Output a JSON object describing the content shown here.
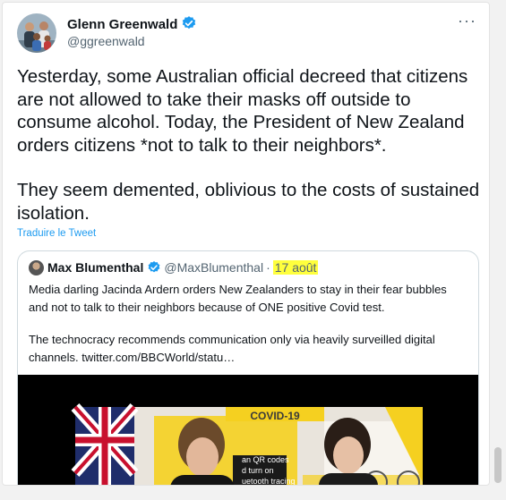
{
  "tweet": {
    "author_name": "Glenn Greenwald",
    "author_handle": "@ggreenwald",
    "more_label": "···",
    "paragraph1": "Yesterday, some Australian official decreed that citizens are not allowed to take their masks off outside to consume alcohol. Today, the President of New Zealand orders citizens *not to talk to their neighbors*.",
    "paragraph2": "They seem demented, oblivious to the costs of sustained isolation.",
    "translate_label": "Traduire le Tweet"
  },
  "quote": {
    "author_name": "Max Blumenthal",
    "author_handle": "@MaxBlumenthal",
    "separator": "·",
    "date": "17 août",
    "paragraph1": "Media darling Jacinda Ardern orders New Zealanders to stay in their fear bubbles and not to talk to their neighbors because of ONE positive Covid test.",
    "paragraph2": "The technocracy recommends communication only via heavily surveilled digital channels.  twitter.com/BBCWorld/statu…",
    "video": {
      "banner": "COVID-19",
      "sign_lines": [
        "an QR codes",
        "d turn on",
        "uetooth tracing"
      ]
    }
  },
  "colors": {
    "link": "#1d9bf0",
    "verified": "#1d9bf0",
    "highlight": "#ffff3d",
    "covid_yellow": "#f5d020"
  }
}
